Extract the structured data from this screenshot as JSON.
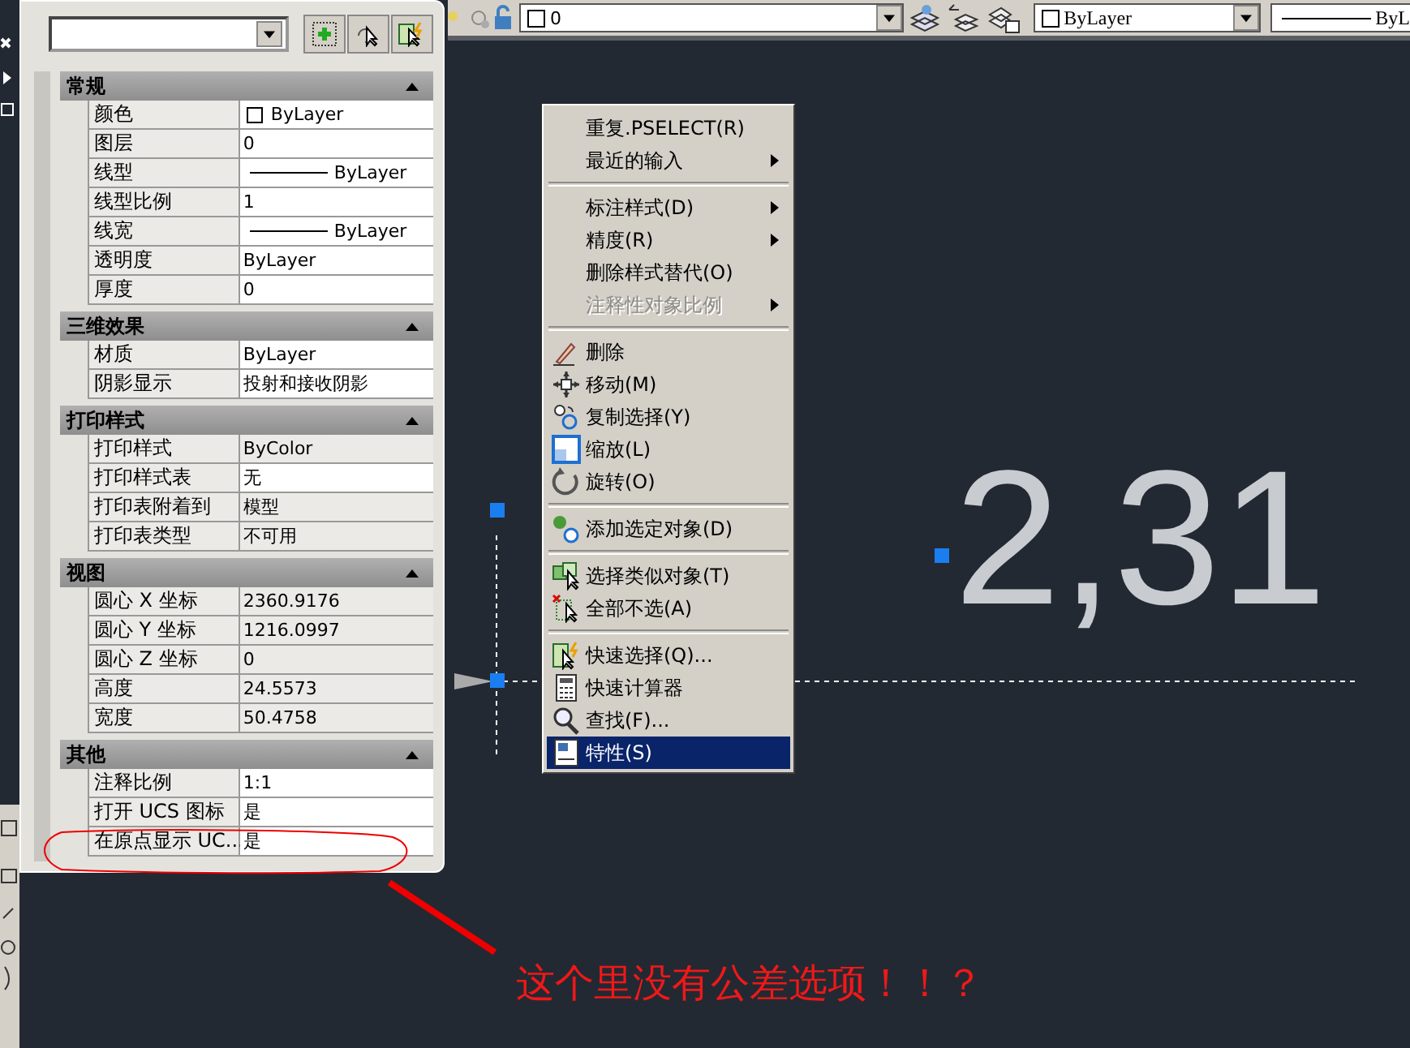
{
  "toolbar": {
    "layer_value": "0",
    "color_value": "ByLayer",
    "linetype_value": "ByL"
  },
  "palette": {
    "sections": [
      {
        "title": "常规",
        "expanded": true,
        "rows": [
          {
            "name": "颜色",
            "value": "ByLayer",
            "kind": "color",
            "read_only": false
          },
          {
            "name": "图层",
            "value": "0",
            "kind": "text",
            "read_only": false
          },
          {
            "name": "线型",
            "value": "ByLayer",
            "kind": "line",
            "read_only": false
          },
          {
            "name": "线型比例",
            "value": "1",
            "kind": "text",
            "read_only": false
          },
          {
            "name": "线宽",
            "value": "ByLayer",
            "kind": "line",
            "read_only": false
          },
          {
            "name": "透明度",
            "value": "ByLayer",
            "kind": "text",
            "read_only": false
          },
          {
            "name": "厚度",
            "value": "0",
            "kind": "text",
            "read_only": false
          }
        ]
      },
      {
        "title": "三维效果",
        "expanded": true,
        "rows": [
          {
            "name": "材质",
            "value": "ByLayer",
            "kind": "text",
            "read_only": false
          },
          {
            "name": "阴影显示",
            "value": "投射和接收阴影",
            "kind": "text",
            "read_only": false
          }
        ]
      },
      {
        "title": "打印样式",
        "expanded": true,
        "rows": [
          {
            "name": "打印样式",
            "value": "ByColor",
            "kind": "text",
            "read_only": true
          },
          {
            "name": "打印样式表",
            "value": "无",
            "kind": "text",
            "read_only": false
          },
          {
            "name": "打印表附着到",
            "value": "模型",
            "kind": "text",
            "read_only": true
          },
          {
            "name": "打印表类型",
            "value": "不可用",
            "kind": "text",
            "read_only": true
          }
        ]
      },
      {
        "title": "视图",
        "expanded": true,
        "rows": [
          {
            "name": "圆心 X 坐标",
            "value": "2360.9176",
            "kind": "text",
            "read_only": true
          },
          {
            "name": "圆心 Y 坐标",
            "value": "1216.0997",
            "kind": "text",
            "read_only": true
          },
          {
            "name": "圆心 Z 坐标",
            "value": "0",
            "kind": "text",
            "read_only": true
          },
          {
            "name": "高度",
            "value": "24.5573",
            "kind": "text",
            "read_only": true
          },
          {
            "name": "宽度",
            "value": "50.4758",
            "kind": "text",
            "read_only": true
          }
        ]
      },
      {
        "title": "其他",
        "expanded": true,
        "rows": [
          {
            "name": "注释比例",
            "value": "1:1",
            "kind": "text",
            "read_only": false
          },
          {
            "name": "打开 UCS 图标",
            "value": "是",
            "kind": "text",
            "read_only": false
          },
          {
            "name": "在原点显示 UC...",
            "value": "是",
            "kind": "text",
            "read_only": false
          }
        ]
      }
    ]
  },
  "context_menu": [
    {
      "kind": "item",
      "label": "重复.PSELECT(R)",
      "submenu": false,
      "disabled": false,
      "selected": false
    },
    {
      "kind": "item",
      "label": "最近的输入",
      "submenu": true,
      "disabled": false,
      "selected": false
    },
    {
      "kind": "separator"
    },
    {
      "kind": "item",
      "label": "标注样式(D)",
      "submenu": true,
      "disabled": false,
      "selected": false
    },
    {
      "kind": "item",
      "label": "精度(R)",
      "submenu": true,
      "disabled": false,
      "selected": false
    },
    {
      "kind": "item",
      "label": "删除样式替代(O)",
      "submenu": false,
      "disabled": false,
      "selected": false
    },
    {
      "kind": "item",
      "label": "注释性对象比例",
      "submenu": true,
      "disabled": true,
      "selected": false
    },
    {
      "kind": "separator"
    },
    {
      "kind": "icon_item",
      "label": "删除",
      "submenu": false,
      "disabled": false,
      "selected": false
    },
    {
      "kind": "icon_item",
      "label": "移动(M)",
      "submenu": false,
      "disabled": false,
      "selected": false
    },
    {
      "kind": "icon_item",
      "label": "复制选择(Y)",
      "submenu": false,
      "disabled": false,
      "selected": false
    },
    {
      "kind": "icon_item",
      "label": "缩放(L)",
      "submenu": false,
      "disabled": false,
      "selected": false
    },
    {
      "kind": "icon_item",
      "label": "旋转(O)",
      "submenu": false,
      "disabled": false,
      "selected": false
    },
    {
      "kind": "separator"
    },
    {
      "kind": "icon_item",
      "label": "添加选定对象(D)",
      "submenu": false,
      "disabled": false,
      "selected": false
    },
    {
      "kind": "separator"
    },
    {
      "kind": "icon_item",
      "label": "选择类似对象(T)",
      "submenu": false,
      "disabled": false,
      "selected": false
    },
    {
      "kind": "icon_item",
      "label": "全部不选(A)",
      "submenu": false,
      "disabled": false,
      "selected": false
    },
    {
      "kind": "separator"
    },
    {
      "kind": "icon_item",
      "label": "快速选择(Q)...",
      "submenu": false,
      "disabled": false,
      "selected": false
    },
    {
      "kind": "icon_item",
      "label": "快速计算器",
      "submenu": false,
      "disabled": false,
      "selected": false
    },
    {
      "kind": "icon_item",
      "label": "查找(F)...",
      "submenu": false,
      "disabled": false,
      "selected": false
    },
    {
      "kind": "icon_item",
      "label": "特性(S)",
      "submenu": false,
      "disabled": false,
      "selected": true
    }
  ],
  "drawing": {
    "dimension_text": "2,31"
  },
  "annotation": {
    "text": "这个里没有公差选项！！？"
  }
}
